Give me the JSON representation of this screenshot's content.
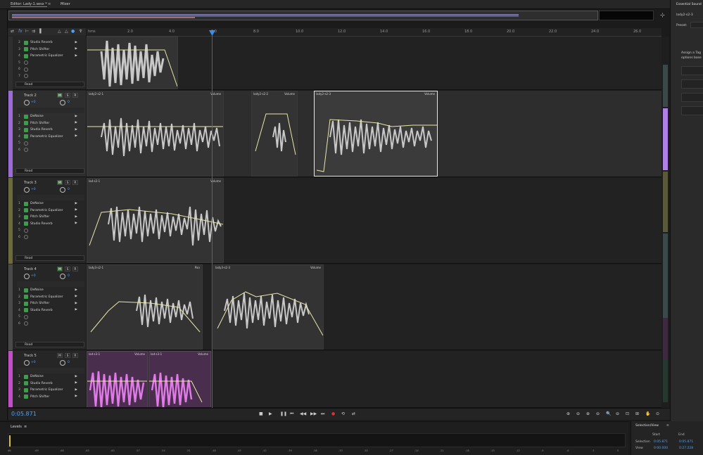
{
  "tabs": [
    {
      "label": "Editor: Lady-1.sesx *"
    },
    {
      "label": "Mixer"
    }
  ],
  "ruler": [
    "hms",
    "2.0",
    "4.0",
    "6.0",
    "8.0",
    "10.0",
    "12.0",
    "14.0",
    "16.0",
    "18.0",
    "20.0",
    "22.0",
    "24.0",
    "26.0"
  ],
  "read_label": "Read",
  "fx_label": "fx",
  "m_label": "M",
  "s_label": "S",
  "r_label": "R",
  "tracks": [
    {
      "name": "Track 2",
      "color": "#9b6bd6",
      "vol": "+0",
      "pan": "0",
      "effects": [
        "DeNoise",
        "Pitch Shifter",
        "Studio Reverb",
        "Parametric Equalizer"
      ],
      "clips": [
        {
          "name": "lady2-s2-1",
          "vol": "Volume"
        },
        {
          "name": "lady2-s2-2",
          "vol": "Volume"
        },
        {
          "name": "lady2-s2-3",
          "vol": "Volume"
        }
      ]
    },
    {
      "name": "Track 3",
      "color": "#6b6b3a",
      "vol": "+0",
      "pan": "0",
      "effects": [
        "DeNoise",
        "Parametric Equalizer",
        "Pitch Shifter",
        "Studio Reverb"
      ],
      "clips": [
        {
          "name": "lad-s2-1",
          "vol": "Volume"
        }
      ]
    },
    {
      "name": "Track 4",
      "color": "#5a5a5a",
      "vol": "+0",
      "pan": "0",
      "effects": [
        "DeNoise",
        "Parametric Equalizer",
        "Pitch Shifter",
        "Studio Reverb"
      ],
      "clips": [
        {
          "name": "lady3-s2-1",
          "vol": "Pan"
        },
        {
          "name": "lady3-s2-3",
          "vol": "Volume"
        }
      ]
    },
    {
      "name": "Track 5",
      "color": "#c24fc6",
      "vol": "+0",
      "pan": "0",
      "effects": [
        "DeNoise",
        "Studio Reverb",
        "Parametric Equalizer",
        "Pitch Shifter"
      ],
      "clips": [
        {
          "name": "lad-s3-1",
          "vol": "Volume"
        },
        {
          "name": "lad-s3-1",
          "vol": "Volume"
        }
      ]
    }
  ],
  "track1_effects": [
    "Studio Reverb",
    "Pitch Shifter",
    "Parametric Equalizer"
  ],
  "timecode": "0:05.871",
  "levels_title": "Levels",
  "level_scale": [
    "dB",
    "-69",
    "-66",
    "-63",
    "-60",
    "-57",
    "-54",
    "-51",
    "-48",
    "-45",
    "-42",
    "-39",
    "-36",
    "-33",
    "-30",
    "-27",
    "-24",
    "-21",
    "-18",
    "-15",
    "-12",
    "-9",
    "-6",
    "-3",
    "0"
  ],
  "selection_view": {
    "title": "Selection/View",
    "start_label": "Start",
    "end_label": "End",
    "selection_label": "Selection",
    "view_label": "View",
    "sel_start": "0:05.871",
    "sel_end": "0:05.871",
    "view_start": "0:00.000",
    "view_end": "0:27.228"
  },
  "essential": {
    "title": "Essential Sound",
    "clip": "lady2-s2-3",
    "preset": "Preset:",
    "assign": "Assign a Tag",
    "options": "options base"
  }
}
